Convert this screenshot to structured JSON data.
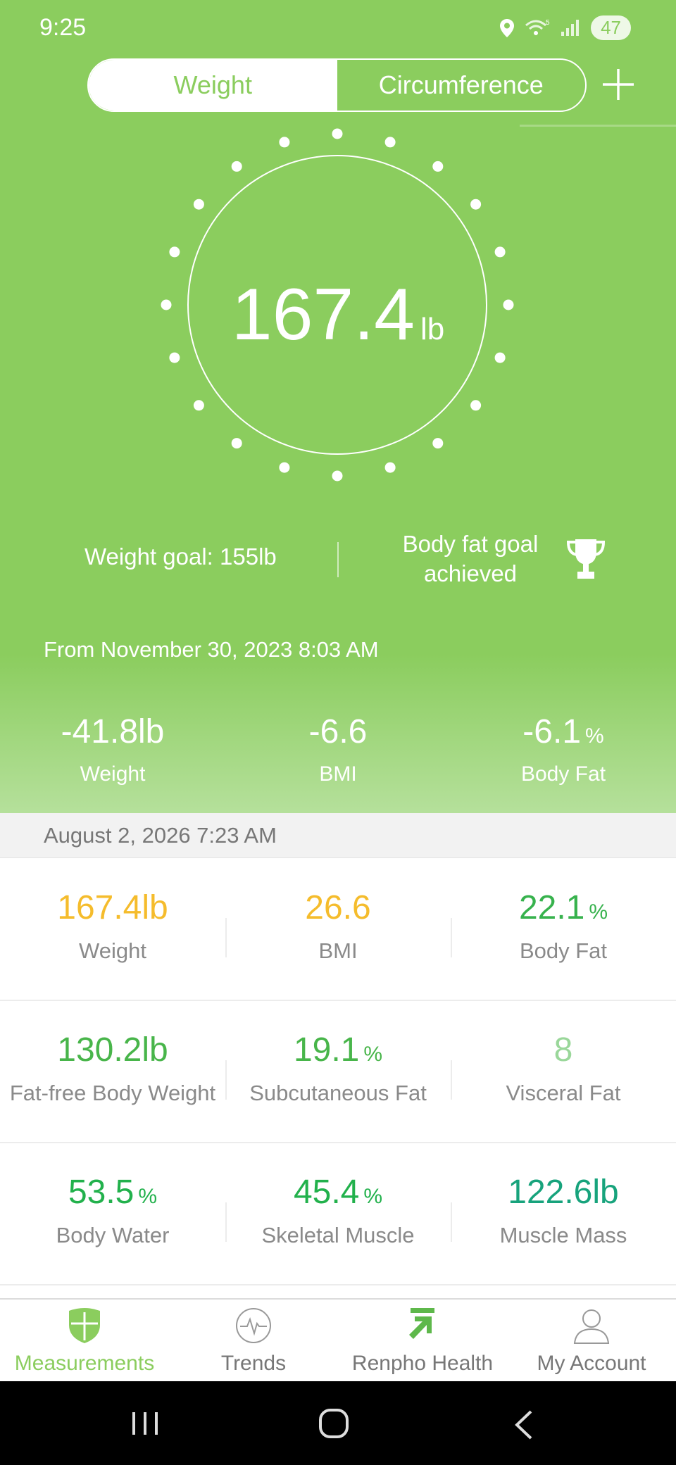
{
  "status": {
    "time": "9:25",
    "battery": "47"
  },
  "tabs": {
    "weight": "Weight",
    "circumference": "Circumference"
  },
  "current": {
    "value": "167.4",
    "unit": "lb"
  },
  "goals": {
    "weight_goal": "Weight goal: 155lb",
    "body_fat_line1": "Body fat goal",
    "body_fat_line2": "achieved"
  },
  "from_text": "From November 30, 2023 8:03 AM",
  "changes": {
    "weight": {
      "value": "-41.8lb",
      "label": "Weight"
    },
    "bmi": {
      "value": "-6.6",
      "label": "BMI"
    },
    "body_fat": {
      "value": "-6.1",
      "unit": "%",
      "label": "Body Fat"
    }
  },
  "measurement_date": "August 2, 2026 7:23 AM",
  "metrics": [
    [
      {
        "value": "167.4lb",
        "unit": "",
        "label": "Weight",
        "color": "#f5bc2c"
      },
      {
        "value": "26.6",
        "unit": "",
        "label": "BMI",
        "color": "#f5bc2c"
      },
      {
        "value": "22.1",
        "unit": "%",
        "label": "Body Fat",
        "color": "#37b24d"
      }
    ],
    [
      {
        "value": "130.2lb",
        "unit": "",
        "label": "Fat-free Body Weight",
        "color": "#48b54a"
      },
      {
        "value": "19.1",
        "unit": "%",
        "label": "Subcutaneous Fat",
        "color": "#48b54a"
      },
      {
        "value": "8",
        "unit": "",
        "label": "Visceral Fat",
        "color": "#9ad79a"
      }
    ],
    [
      {
        "value": "53.5",
        "unit": "%",
        "label": "Body Water",
        "color": "#22b14c"
      },
      {
        "value": "45.4",
        "unit": "%",
        "label": "Skeletal Muscle",
        "color": "#22b14c"
      },
      {
        "value": "122.6lb",
        "unit": "",
        "label": "Muscle Mass",
        "color": "#17a37c"
      }
    ]
  ],
  "nav": {
    "measurements": "Measurements",
    "trends": "Trends",
    "renpho_health": "Renpho Health",
    "my_account": "My Account"
  },
  "colors": {
    "accent": "#8bcd5e"
  }
}
